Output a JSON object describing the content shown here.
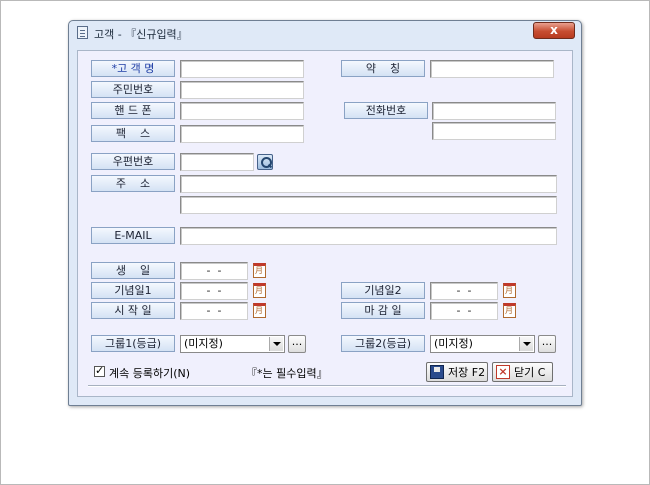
{
  "window": {
    "title": "고객 - 『신규입력』",
    "close_glyph": "x"
  },
  "labels": {
    "customer_name": "*고 객 명",
    "nickname": "약    칭",
    "resident_no": "주민번호",
    "mobile": "핸 드 폰",
    "phone": "전화번호",
    "fax": "팩    스",
    "postal_code": "우편번호",
    "address": "주    소",
    "email": "E-MAIL",
    "birthday": "생    일",
    "anniversary1": "기념일1",
    "anniversary2": "기념일2",
    "start_date": "시 작 일",
    "end_date": "마 감 일",
    "group1": "그룹1(등급)",
    "group2": "그룹2(등급)"
  },
  "dates": {
    "birthday": "-  -",
    "anniversary1": "-  -",
    "anniversary2": "-  -",
    "start_date": "-  -",
    "end_date": "-  -"
  },
  "groups": {
    "group1_value": "(미지정)",
    "group2_value": "(미지정)",
    "dots": "..."
  },
  "footer": {
    "continue_register": "계속 등록하기(N)",
    "required_note": "『*는 필수입력』",
    "save_label": "저장 F2",
    "close_label": "닫기 C"
  },
  "icons": {
    "app": "document-icon",
    "close": "close-icon",
    "search": "search-icon",
    "calendar": "calendar-icon",
    "dropdown": "chevron-down-icon",
    "save": "floppy-disk-icon",
    "cancel": "x-icon"
  },
  "colors": {
    "window_bg": "#dfe9f7",
    "client_bg": "#f0f0fd",
    "label_border": "#8aa2c4",
    "required_text": "#1f3ea6",
    "close_button": "#c74d31"
  }
}
